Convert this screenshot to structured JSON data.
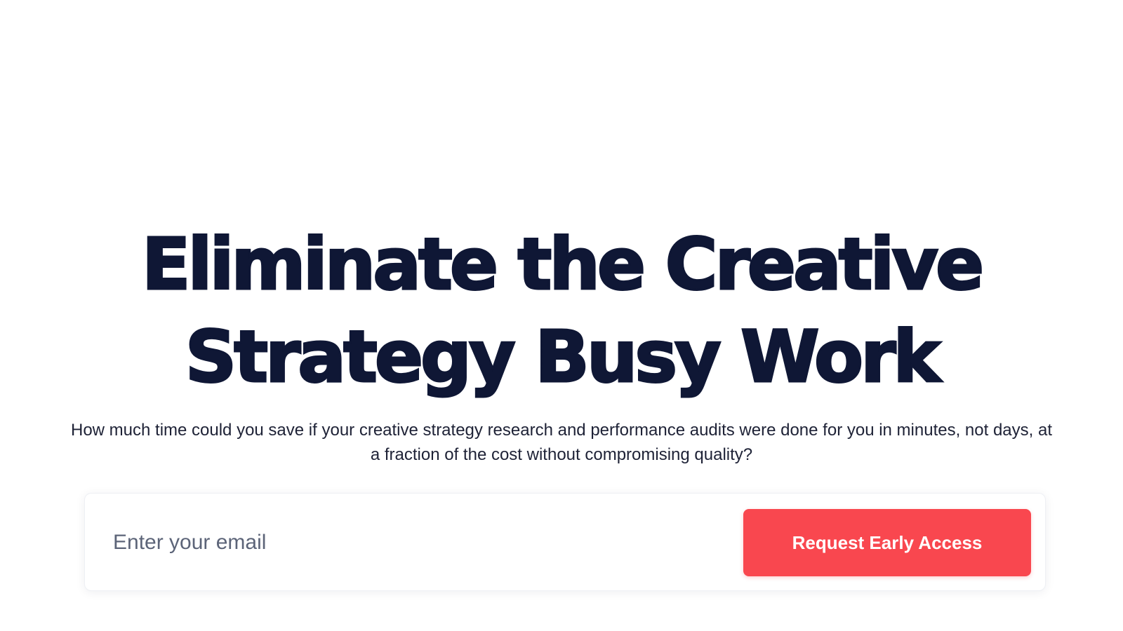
{
  "hero": {
    "headline_line1": "Eliminate the Creative",
    "headline_line2": "Strategy Busy Work",
    "subtext": "How much time could you save if your creative strategy research and performance audits were done for you in minutes, not days, at a fraction of the cost without compromising quality?"
  },
  "signup": {
    "email_placeholder": "Enter your email",
    "email_value": "",
    "button_label": "Request Early Access"
  },
  "colors": {
    "headline": "#0f1735",
    "body_text": "#1e2236",
    "accent": "#f9474f",
    "background": "#ffffff"
  }
}
